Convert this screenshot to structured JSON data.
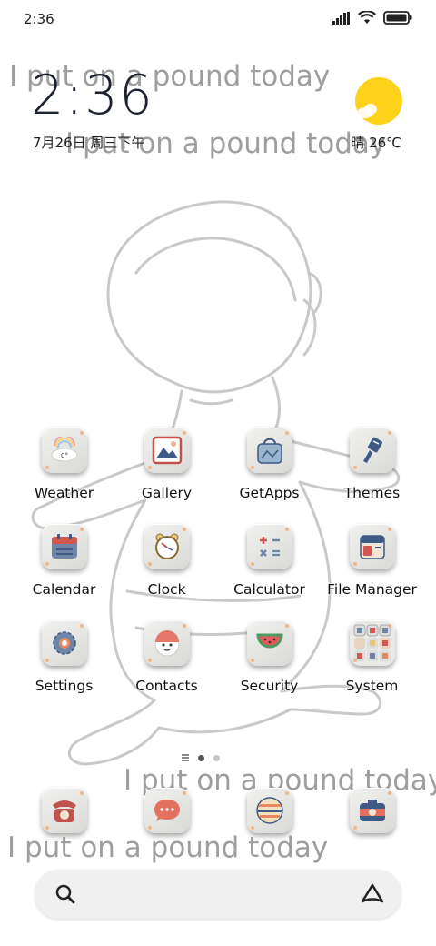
{
  "status_bar": {
    "time": "2:36",
    "icons": [
      "signal-icon",
      "wifi-icon",
      "battery-icon"
    ]
  },
  "watermarks": [
    "I put on a pound today",
    "I put on a pound today",
    "I put on a pound today",
    "I put on a pound today"
  ],
  "clock_widget": {
    "time": "2:36",
    "date": "7月26日 周三下午",
    "weather": "晴 26℃",
    "weather_icon": "sun-cloud-icon"
  },
  "home_apps": [
    {
      "label": "Weather",
      "icon": "weather-icon"
    },
    {
      "label": "Gallery",
      "icon": "gallery-icon"
    },
    {
      "label": "GetApps",
      "icon": "getapps-icon"
    },
    {
      "label": "Themes",
      "icon": "themes-icon"
    },
    {
      "label": "Calendar",
      "icon": "calendar-icon"
    },
    {
      "label": "Clock",
      "icon": "clock-icon"
    },
    {
      "label": "Calculator",
      "icon": "calculator-icon"
    },
    {
      "label": "File Manager",
      "icon": "file-manager-icon"
    },
    {
      "label": "Settings",
      "icon": "settings-icon"
    },
    {
      "label": "Contacts",
      "icon": "contacts-icon"
    },
    {
      "label": "Security",
      "icon": "security-icon"
    },
    {
      "label": "System",
      "icon": "system-folder-icon"
    }
  ],
  "weather_tile_temp": "0°",
  "page_indicator": {
    "pages": 2,
    "current": 1
  },
  "dock_apps": [
    {
      "icon": "phone-icon"
    },
    {
      "icon": "messaging-icon"
    },
    {
      "icon": "browser-icon"
    },
    {
      "icon": "camera-icon"
    }
  ],
  "search_bar": {
    "left_icon": "search-icon",
    "right_icon": "assistant-icon"
  },
  "colors": {
    "tile_bg": "#e4e4e2",
    "sun": "#ffd21a",
    "dot_active": "#555555",
    "dot_inactive": "#c6c6c6"
  }
}
